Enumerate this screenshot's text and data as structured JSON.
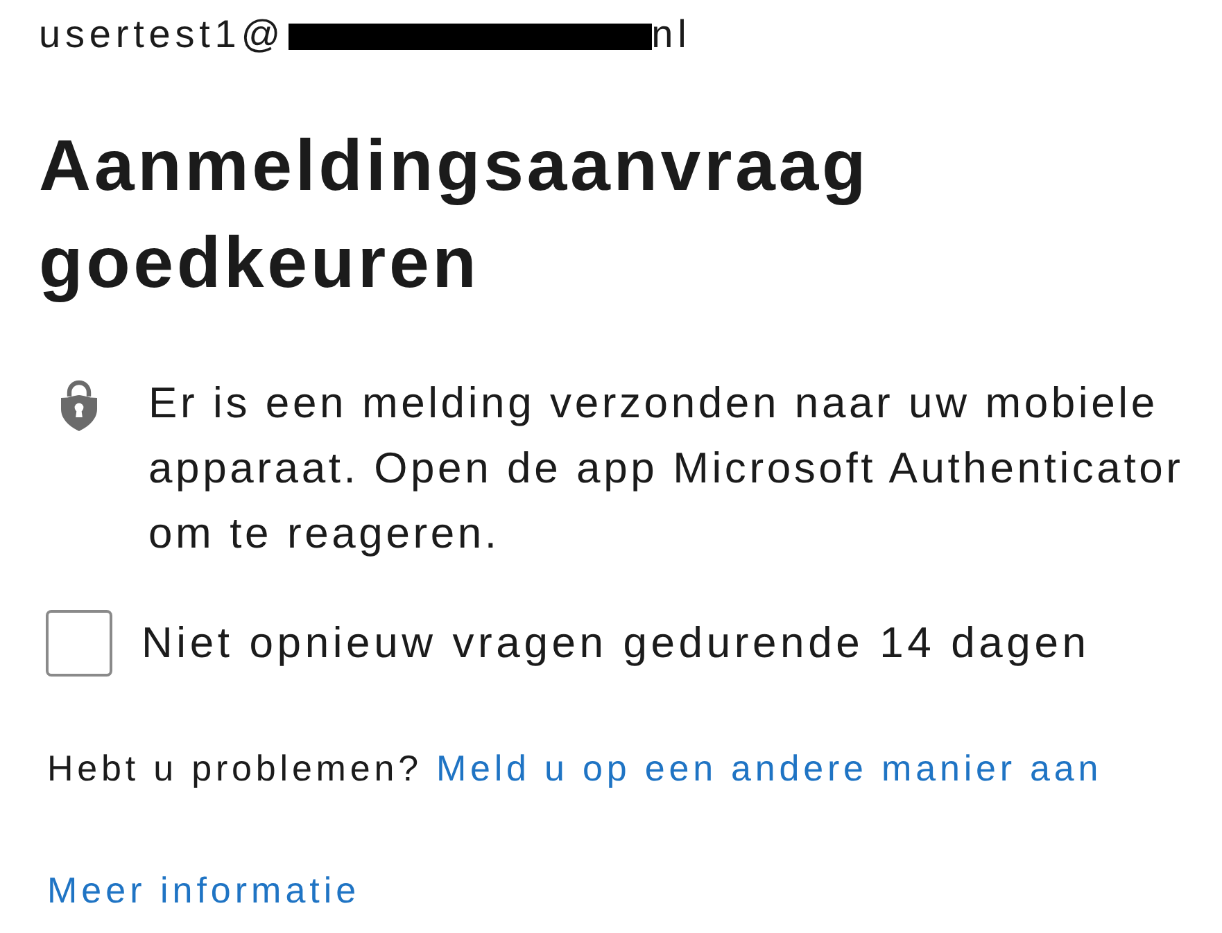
{
  "account": {
    "email_start": "usertest1@",
    "redacted": true,
    "email_end": "nl"
  },
  "title": "Aanmeldingsaanvraag goedkeuren",
  "notice": {
    "text": "Er is een melding verzonden naar uw mobiele apparaat. Open de app Microsoft Authenticator om te reageren."
  },
  "remember": {
    "label": "Niet opnieuw vragen gedurende 14 dagen",
    "checked": false
  },
  "help": {
    "prompt": "Hebt u problemen?",
    "link": "Meld u op een andere manier aan"
  },
  "more_info_link": "Meer informatie"
}
